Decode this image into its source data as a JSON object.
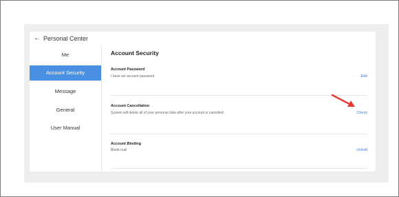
{
  "header": {
    "title": "Personal Center",
    "back_icon": "arrow-left-icon"
  },
  "sidebar": {
    "items": [
      {
        "label": "Me",
        "active": false
      },
      {
        "label": "Account Security",
        "active": true
      },
      {
        "label": "Message",
        "active": false
      },
      {
        "label": "General",
        "active": false
      },
      {
        "label": "User Manual",
        "active": false
      }
    ]
  },
  "main": {
    "title": "Account Security",
    "rows": [
      {
        "title": "Account Password",
        "desc": "I have set account password",
        "action": "Edit"
      },
      {
        "title": "Account Cancellation",
        "desc": "System will delete all of your personal data after your account is cancelled.",
        "action": "Check"
      },
      {
        "title": "Account Binding",
        "desc": "Binde mail",
        "action": "Unfold"
      }
    ]
  },
  "colors": {
    "accent": "#4a90e2",
    "link": "#3a7bd5",
    "annotation_arrow": "#e53935"
  }
}
